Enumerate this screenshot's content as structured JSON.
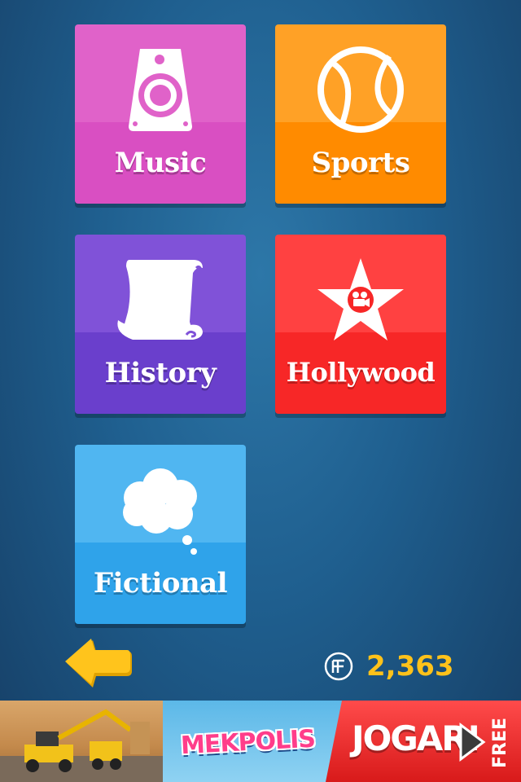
{
  "categories": [
    {
      "label": "Music",
      "icon": "speaker-icon"
    },
    {
      "label": "Sports",
      "icon": "ball-icon"
    },
    {
      "label": "History",
      "icon": "scroll-icon"
    },
    {
      "label": "Hollywood",
      "icon": "star-camera-icon"
    },
    {
      "label": "Fictional",
      "icon": "thought-cloud-icon"
    }
  ],
  "footer": {
    "back_icon": "arrow-left-icon",
    "coin_icon": "coin-icon",
    "coins": "2,363"
  },
  "ad": {
    "logo": "MEKPOLIS",
    "cta": "JOGAR!",
    "tag": "FREE"
  },
  "colors": {
    "music": "#d94fc2",
    "sports": "#ff8b00",
    "history": "#6a3fcc",
    "hollywood": "#f72727",
    "fictional": "#2fa3ea",
    "coins": "#ffc21a"
  }
}
